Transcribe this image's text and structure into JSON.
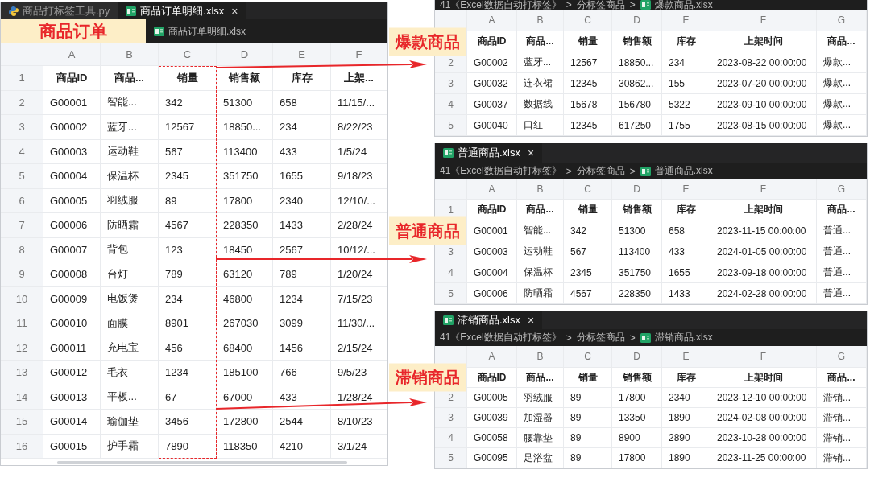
{
  "main_window": {
    "tabs": [
      {
        "label": "商品打标签工具.py",
        "kind": "python",
        "selected": false
      },
      {
        "label": "商品订单明细.xlsx",
        "kind": "excel",
        "selected": true,
        "close": "×"
      }
    ],
    "callout": "商品订单",
    "breadcrumb": [
      {
        "label": "商品订单明细.xlsx",
        "kind": "excel"
      }
    ],
    "sheet": {
      "columns": [
        {
          "letter": "A",
          "highlighted": false
        },
        {
          "letter": "B",
          "highlighted": false
        },
        {
          "letter": "C",
          "highlighted": true
        },
        {
          "letter": "D",
          "highlighted": false
        },
        {
          "letter": "E",
          "highlighted": false
        },
        {
          "letter": "F",
          "highlighted": false
        }
      ],
      "rows": [
        {
          "number": "1",
          "header": true,
          "cells": [
            "商品ID",
            "商品...",
            "销量",
            "销售额",
            "库存",
            "上架..."
          ]
        },
        {
          "number": "2",
          "header": false,
          "cells": [
            "G00001",
            "智能...",
            "342",
            "51300",
            "658",
            "11/15/..."
          ]
        },
        {
          "number": "3",
          "header": false,
          "cells": [
            "G00002",
            "蓝牙...",
            "12567",
            "18850...",
            "234",
            "8/22/23"
          ]
        },
        {
          "number": "4",
          "header": false,
          "cells": [
            "G00003",
            "运动鞋",
            "567",
            "113400",
            "433",
            "1/5/24"
          ]
        },
        {
          "number": "5",
          "header": false,
          "cells": [
            "G00004",
            "保温杯",
            "2345",
            "351750",
            "1655",
            "9/18/23"
          ]
        },
        {
          "number": "6",
          "header": false,
          "cells": [
            "G00005",
            "羽绒服",
            "89",
            "17800",
            "2340",
            "12/10/..."
          ]
        },
        {
          "number": "7",
          "header": false,
          "cells": [
            "G00006",
            "防晒霜",
            "4567",
            "228350",
            "1433",
            "2/28/24"
          ]
        },
        {
          "number": "8",
          "header": false,
          "cells": [
            "G00007",
            "背包",
            "123",
            "18450",
            "2567",
            "10/12/..."
          ]
        },
        {
          "number": "9",
          "header": false,
          "cells": [
            "G00008",
            "台灯",
            "789",
            "63120",
            "789",
            "1/20/24"
          ]
        },
        {
          "number": "10",
          "header": false,
          "cells": [
            "G00009",
            "电饭煲",
            "234",
            "46800",
            "1234",
            "7/15/23"
          ]
        },
        {
          "number": "11",
          "header": false,
          "cells": [
            "G00010",
            "面膜",
            "8901",
            "267030",
            "3099",
            "11/30/..."
          ]
        },
        {
          "number": "12",
          "header": false,
          "cells": [
            "G00011",
            "充电宝",
            "456",
            "68400",
            "1456",
            "2/15/24"
          ]
        },
        {
          "number": "13",
          "header": false,
          "cells": [
            "G00012",
            "毛衣",
            "1234",
            "185100",
            "766",
            "9/5/23"
          ]
        },
        {
          "number": "14",
          "header": false,
          "cells": [
            "G00013",
            "平板...",
            "67",
            "67000",
            "433",
            "1/28/24"
          ]
        },
        {
          "number": "15",
          "header": false,
          "cells": [
            "G00014",
            "瑜伽垫",
            "3456",
            "172800",
            "2544",
            "8/10/23"
          ]
        },
        {
          "number": "16",
          "header": false,
          "cells": [
            "G00015",
            "护手霜",
            "7890",
            "118350",
            "4210",
            "3/1/24"
          ]
        }
      ]
    }
  },
  "result_panels": [
    {
      "breadcrumb": [
        {
          "label": "41《Excel数据自动打标签》"
        },
        {
          "label": "分标签商品"
        },
        {
          "label": "爆款商品.xlsx",
          "kind": "excel"
        }
      ],
      "separator": ">",
      "callout": "爆款商品",
      "columns": [
        "A",
        "B",
        "C",
        "D",
        "E",
        "F",
        "G"
      ],
      "rows": [
        {
          "header": true,
          "cells": [
            "商品ID",
            "商品...",
            "销量",
            "销售额",
            "库存",
            "上架时间",
            "商品..."
          ]
        },
        {
          "number": "2",
          "header": false,
          "cells": [
            "G00002",
            "蓝牙...",
            "12567",
            "18850...",
            "234",
            "2023-08-22 00:00:00",
            "爆款..."
          ]
        },
        {
          "number": "3",
          "header": false,
          "cells": [
            "G00032",
            "连衣裙",
            "12345",
            "30862...",
            "155",
            "2023-07-20 00:00:00",
            "爆款..."
          ]
        },
        {
          "number": "4",
          "header": false,
          "cells": [
            "G00037",
            "数据线",
            "15678",
            "156780",
            "5322",
            "2023-09-10 00:00:00",
            "爆款..."
          ]
        },
        {
          "number": "5",
          "header": false,
          "cells": [
            "G00040",
            "口红",
            "12345",
            "617250",
            "1755",
            "2023-08-15 00:00:00",
            "爆款..."
          ]
        }
      ]
    },
    {
      "tab": {
        "label": "普通商品.xlsx",
        "close": "×"
      },
      "breadcrumb": [
        {
          "label": "41《Excel数据自动打标签》"
        },
        {
          "label": "分标签商品"
        },
        {
          "label": "普通商品.xlsx",
          "kind": "excel"
        }
      ],
      "separator": ">",
      "callout": "普通商品",
      "columns": [
        "A",
        "B",
        "C",
        "D",
        "E",
        "F",
        "G"
      ],
      "rows": [
        {
          "number": "1",
          "header": true,
          "cells": [
            "商品ID",
            "商品...",
            "销量",
            "销售额",
            "库存",
            "上架时间",
            "商品..."
          ]
        },
        {
          "header": false,
          "cells": [
            "G00001",
            "智能...",
            "342",
            "51300",
            "658",
            "2023-11-15 00:00:00",
            "普通..."
          ]
        },
        {
          "number": "3",
          "header": false,
          "cells": [
            "G00003",
            "运动鞋",
            "567",
            "113400",
            "433",
            "2024-01-05 00:00:00",
            "普通..."
          ]
        },
        {
          "number": "4",
          "header": false,
          "cells": [
            "G00004",
            "保温杯",
            "2345",
            "351750",
            "1655",
            "2023-09-18 00:00:00",
            "普通..."
          ]
        },
        {
          "number": "5",
          "header": false,
          "cells": [
            "G00006",
            "防晒霜",
            "4567",
            "228350",
            "1433",
            "2024-02-28 00:00:00",
            "普通..."
          ]
        }
      ]
    },
    {
      "tab": {
        "label": "滞销商品.xlsx",
        "close": "×"
      },
      "breadcrumb": [
        {
          "label": "41《Excel数据自动打标签》"
        },
        {
          "label": "分标签商品"
        },
        {
          "label": "滞销商品.xlsx",
          "kind": "excel"
        }
      ],
      "separator": ">",
      "callout": "滞销商品",
      "columns": [
        "A",
        "B",
        "C",
        "D",
        "E",
        "F",
        "G"
      ],
      "rows": [
        {
          "header": true,
          "cells": [
            "商品ID",
            "商品...",
            "销量",
            "销售额",
            "库存",
            "上架时间",
            "商品..."
          ]
        },
        {
          "number": "2",
          "header": false,
          "cells": [
            "G00005",
            "羽绒服",
            "89",
            "17800",
            "2340",
            "2023-12-10 00:00:00",
            "滞销..."
          ]
        },
        {
          "number": "3",
          "header": false,
          "cells": [
            "G00039",
            "加湿器",
            "89",
            "13350",
            "1890",
            "2024-02-08 00:00:00",
            "滞销..."
          ]
        },
        {
          "number": "4",
          "header": false,
          "cells": [
            "G00058",
            "腰靠垫",
            "89",
            "8900",
            "2890",
            "2023-10-28 00:00:00",
            "滞销..."
          ]
        },
        {
          "number": "5",
          "header": false,
          "cells": [
            "G00095",
            "足浴盆",
            "89",
            "17800",
            "1890",
            "2023-11-25 00:00:00",
            "滞销..."
          ]
        }
      ]
    }
  ]
}
